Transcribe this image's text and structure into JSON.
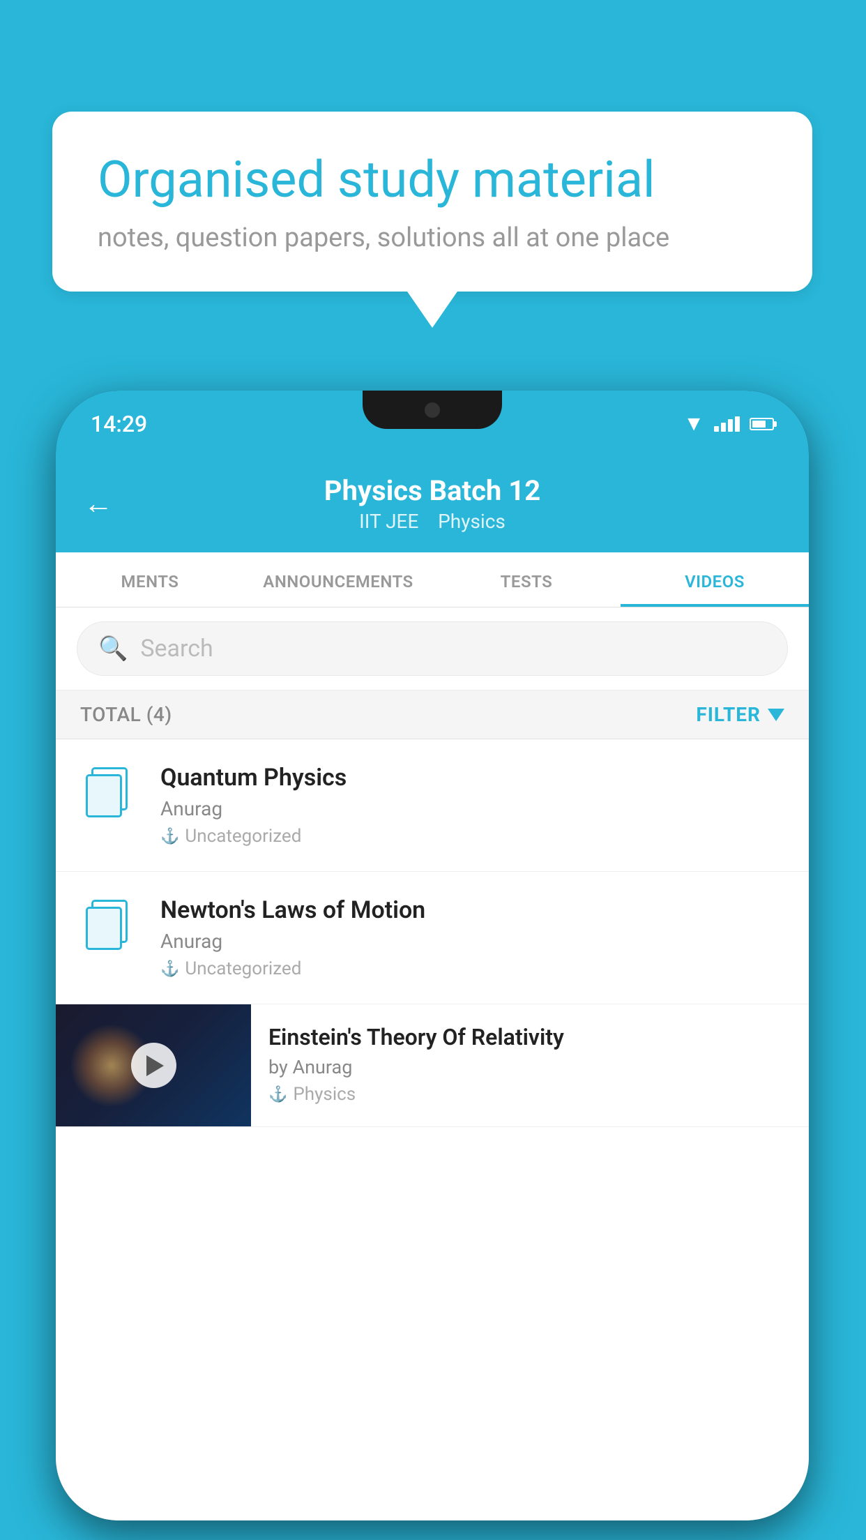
{
  "background_color": "#29b6d8",
  "bubble": {
    "title": "Organised study material",
    "subtitle": "notes, question papers, solutions all at one place"
  },
  "phone": {
    "status_time": "14:29",
    "header": {
      "title": "Physics Batch 12",
      "subtitle_part1": "IIT JEE",
      "subtitle_part2": "Physics"
    },
    "tabs": [
      {
        "label": "MENTS",
        "active": false
      },
      {
        "label": "ANNOUNCEMENTS",
        "active": false
      },
      {
        "label": "TESTS",
        "active": false
      },
      {
        "label": "VIDEOS",
        "active": true
      }
    ],
    "search_placeholder": "Search",
    "total_label": "TOTAL (4)",
    "filter_label": "FILTER",
    "videos": [
      {
        "title": "Quantum Physics",
        "author": "Anurag",
        "tag": "Uncategorized",
        "has_thumbnail": false
      },
      {
        "title": "Newton's Laws of Motion",
        "author": "Anurag",
        "tag": "Uncategorized",
        "has_thumbnail": false
      },
      {
        "title": "Einstein's Theory Of Relativity",
        "author": "by Anurag",
        "tag": "Physics",
        "has_thumbnail": true
      }
    ]
  }
}
